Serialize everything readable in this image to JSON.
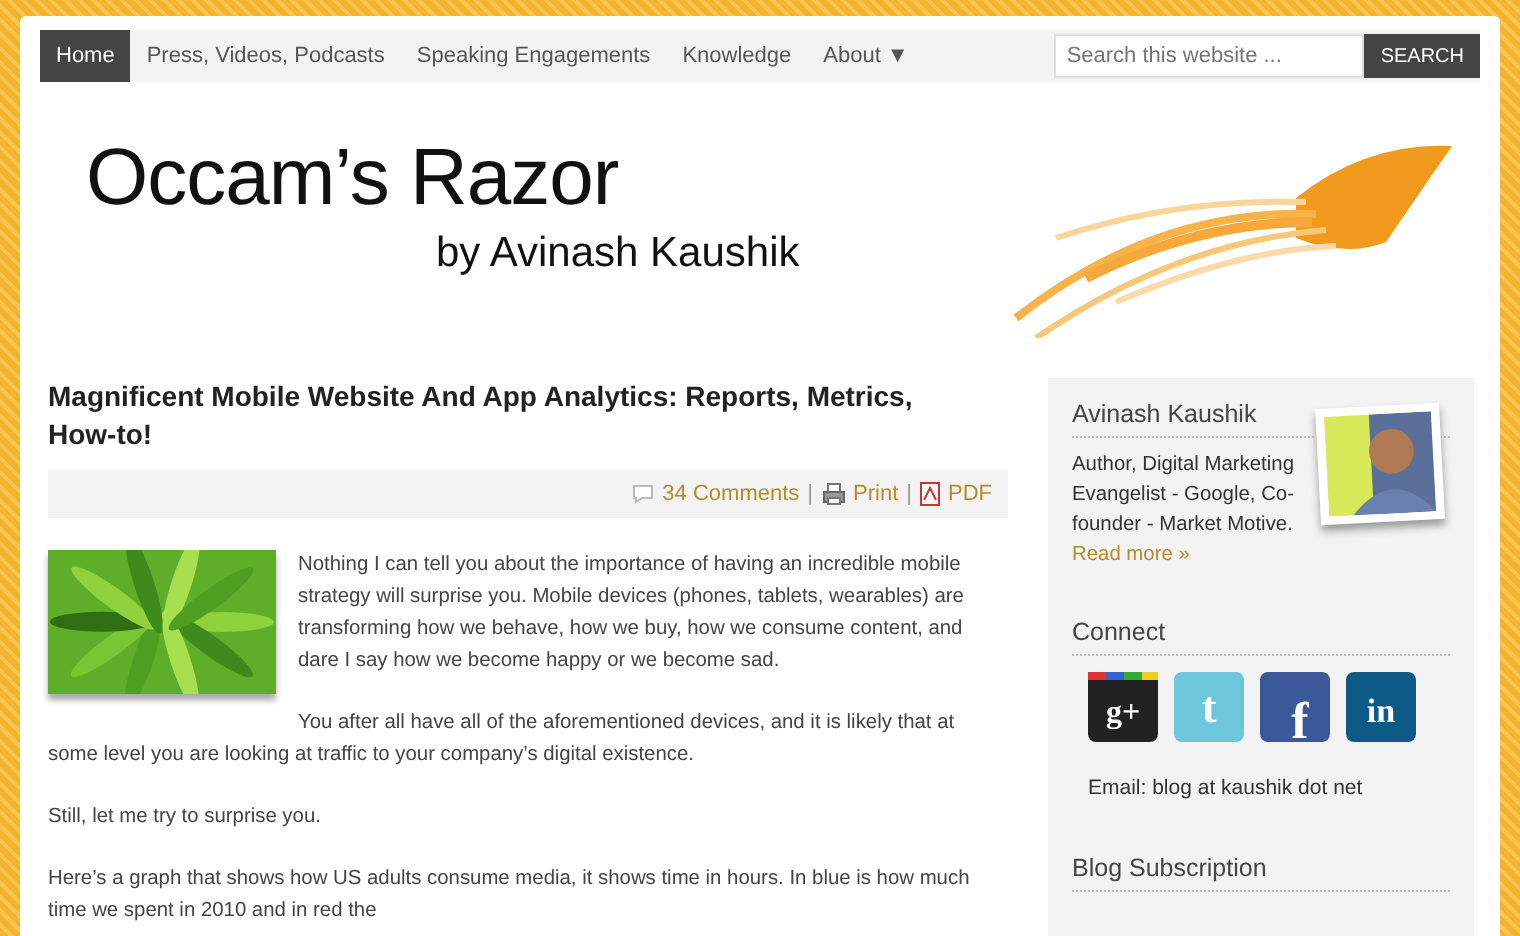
{
  "nav": {
    "items": [
      {
        "label": "Home",
        "selected": true
      },
      {
        "label": "Press, Videos, Podcasts",
        "selected": false
      },
      {
        "label": "Speaking Engagements",
        "selected": false
      },
      {
        "label": "Knowledge",
        "selected": false
      },
      {
        "label": "About ▼",
        "selected": false
      }
    ]
  },
  "search": {
    "placeholder": "Search this website ...",
    "button": "SEARCH"
  },
  "logo": {
    "title": "Occam’s Razor",
    "subtitle": "by Avinash Kaushik"
  },
  "post": {
    "title": "Magnificent Mobile Website And App Analytics: Reports, Metrics, How-to!",
    "meta": [
      {
        "kind": "comments",
        "label": "34 Comments"
      },
      {
        "kind": "separator",
        "label": "|"
      },
      {
        "kind": "print",
        "label": "Print"
      },
      {
        "kind": "separator",
        "label": "|"
      },
      {
        "kind": "pdf",
        "label": "PDF"
      }
    ],
    "image": {
      "kind": "picture"
    },
    "paragraphs": [
      "Nothing I can tell you about the importance of having an incredible mobile strategy will surprise you. Mobile devices (phones, tablets, wearables) are transforming how we behave, how we buy, how we consume content, and dare I say how we become happy or we become sad.",
      "You after all have all of the aforementioned devices, and it is likely that at some level you are looking at traffic to your company’s digital existence.",
      "Still, let me try to surprise you.",
      "Here’s a graph that shows how US adults consume media, it shows time in hours. In blue is how much time we spent in 2010 and in red the"
    ]
  },
  "sidebar": {
    "about": {
      "title": "Avinash Kaushik",
      "text": "Author, Digital Marketing Evangelist - Google, Co-founder - Market Motive.",
      "link": "Read more »"
    },
    "connect": {
      "title": "Connect",
      "links": [
        {
          "kind": "google-plus",
          "glyph": "g+"
        },
        {
          "kind": "twitter",
          "glyph": "t"
        },
        {
          "kind": "facebook",
          "glyph": "f"
        },
        {
          "kind": "linkedin",
          "glyph": "in"
        }
      ],
      "email": "Email: blog at kaushik dot net"
    },
    "subscription": {
      "title": "Blog Subscription"
    }
  }
}
